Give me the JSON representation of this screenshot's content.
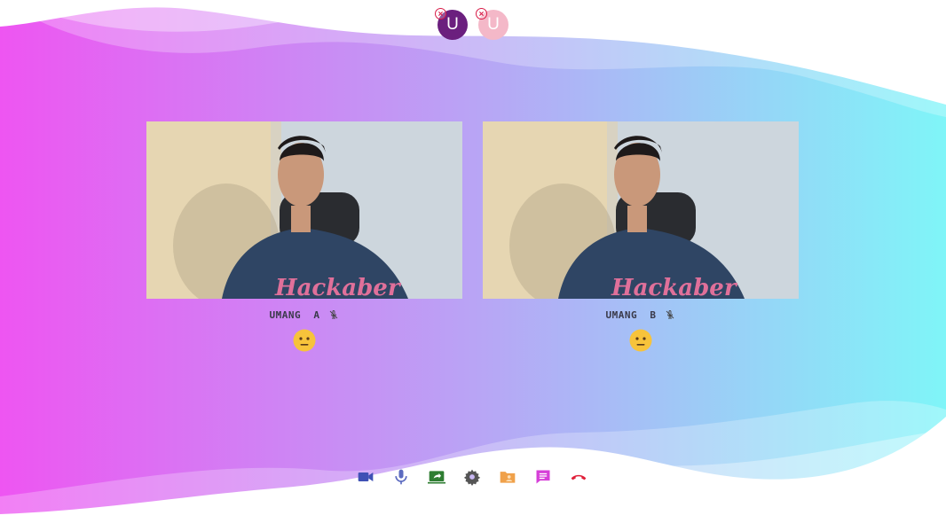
{
  "participants": [
    {
      "initial": "U",
      "name": "UMANG  A",
      "color": "#6b1f7e"
    },
    {
      "initial": "U",
      "name": "UMANG  B",
      "color": "#f4b8c8"
    }
  ],
  "tiles": [
    {
      "name": "UMANG  A",
      "mic": "mic-off-icon",
      "reaction": "neutral-face-emoji"
    },
    {
      "name": "UMANG  B",
      "mic": "mic-off-icon",
      "reaction": "neutral-face-emoji"
    }
  ],
  "video_overlay": {
    "shirt_text": "Hackaber"
  },
  "controls": [
    {
      "icon": "video-camera-icon",
      "color": "#3f51b5"
    },
    {
      "icon": "microphone-icon",
      "color": "#5c6bc0"
    },
    {
      "icon": "screen-share-icon",
      "color": "#2e7d32"
    },
    {
      "icon": "settings-gear-icon",
      "color": "#555555"
    },
    {
      "icon": "contact-folder-icon",
      "color": "#f0a14a"
    },
    {
      "icon": "chat-icon",
      "color": "#d63fd8"
    },
    {
      "icon": "end-call-icon",
      "color": "#e0203a"
    }
  ],
  "colors": {
    "gradient_left": "#ee55f2",
    "gradient_mid": "#b9a4f5",
    "gradient_right": "#7ff5f8"
  }
}
